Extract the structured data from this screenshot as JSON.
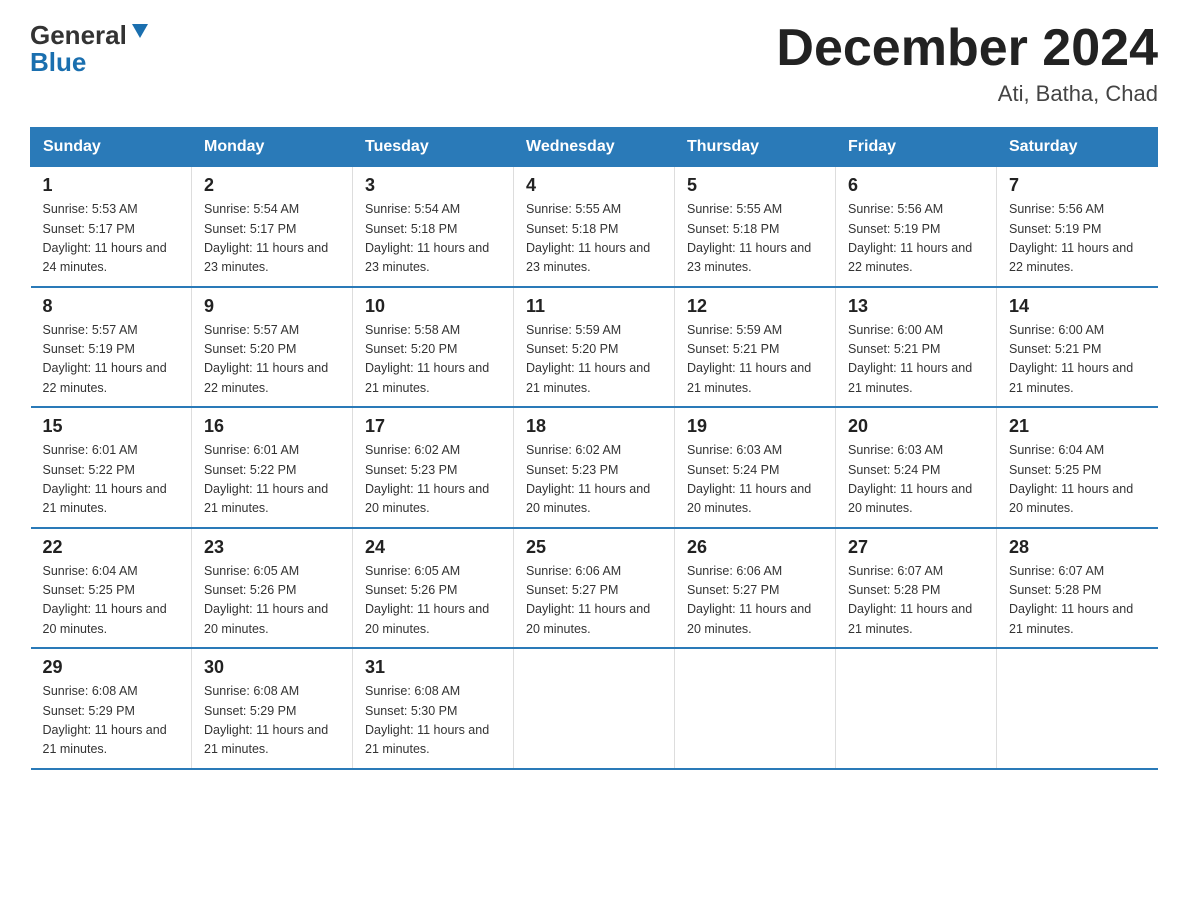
{
  "header": {
    "title": "December 2024",
    "location": "Ati, Batha, Chad",
    "logo_general": "General",
    "logo_blue": "Blue"
  },
  "days_of_week": [
    "Sunday",
    "Monday",
    "Tuesday",
    "Wednesday",
    "Thursday",
    "Friday",
    "Saturday"
  ],
  "weeks": [
    [
      {
        "day": "1",
        "sunrise": "5:53 AM",
        "sunset": "5:17 PM",
        "daylight": "11 hours and 24 minutes."
      },
      {
        "day": "2",
        "sunrise": "5:54 AM",
        "sunset": "5:17 PM",
        "daylight": "11 hours and 23 minutes."
      },
      {
        "day": "3",
        "sunrise": "5:54 AM",
        "sunset": "5:18 PM",
        "daylight": "11 hours and 23 minutes."
      },
      {
        "day": "4",
        "sunrise": "5:55 AM",
        "sunset": "5:18 PM",
        "daylight": "11 hours and 23 minutes."
      },
      {
        "day": "5",
        "sunrise": "5:55 AM",
        "sunset": "5:18 PM",
        "daylight": "11 hours and 23 minutes."
      },
      {
        "day": "6",
        "sunrise": "5:56 AM",
        "sunset": "5:19 PM",
        "daylight": "11 hours and 22 minutes."
      },
      {
        "day": "7",
        "sunrise": "5:56 AM",
        "sunset": "5:19 PM",
        "daylight": "11 hours and 22 minutes."
      }
    ],
    [
      {
        "day": "8",
        "sunrise": "5:57 AM",
        "sunset": "5:19 PM",
        "daylight": "11 hours and 22 minutes."
      },
      {
        "day": "9",
        "sunrise": "5:57 AM",
        "sunset": "5:20 PM",
        "daylight": "11 hours and 22 minutes."
      },
      {
        "day": "10",
        "sunrise": "5:58 AM",
        "sunset": "5:20 PM",
        "daylight": "11 hours and 21 minutes."
      },
      {
        "day": "11",
        "sunrise": "5:59 AM",
        "sunset": "5:20 PM",
        "daylight": "11 hours and 21 minutes."
      },
      {
        "day": "12",
        "sunrise": "5:59 AM",
        "sunset": "5:21 PM",
        "daylight": "11 hours and 21 minutes."
      },
      {
        "day": "13",
        "sunrise": "6:00 AM",
        "sunset": "5:21 PM",
        "daylight": "11 hours and 21 minutes."
      },
      {
        "day": "14",
        "sunrise": "6:00 AM",
        "sunset": "5:21 PM",
        "daylight": "11 hours and 21 minutes."
      }
    ],
    [
      {
        "day": "15",
        "sunrise": "6:01 AM",
        "sunset": "5:22 PM",
        "daylight": "11 hours and 21 minutes."
      },
      {
        "day": "16",
        "sunrise": "6:01 AM",
        "sunset": "5:22 PM",
        "daylight": "11 hours and 21 minutes."
      },
      {
        "day": "17",
        "sunrise": "6:02 AM",
        "sunset": "5:23 PM",
        "daylight": "11 hours and 20 minutes."
      },
      {
        "day": "18",
        "sunrise": "6:02 AM",
        "sunset": "5:23 PM",
        "daylight": "11 hours and 20 minutes."
      },
      {
        "day": "19",
        "sunrise": "6:03 AM",
        "sunset": "5:24 PM",
        "daylight": "11 hours and 20 minutes."
      },
      {
        "day": "20",
        "sunrise": "6:03 AM",
        "sunset": "5:24 PM",
        "daylight": "11 hours and 20 minutes."
      },
      {
        "day": "21",
        "sunrise": "6:04 AM",
        "sunset": "5:25 PM",
        "daylight": "11 hours and 20 minutes."
      }
    ],
    [
      {
        "day": "22",
        "sunrise": "6:04 AM",
        "sunset": "5:25 PM",
        "daylight": "11 hours and 20 minutes."
      },
      {
        "day": "23",
        "sunrise": "6:05 AM",
        "sunset": "5:26 PM",
        "daylight": "11 hours and 20 minutes."
      },
      {
        "day": "24",
        "sunrise": "6:05 AM",
        "sunset": "5:26 PM",
        "daylight": "11 hours and 20 minutes."
      },
      {
        "day": "25",
        "sunrise": "6:06 AM",
        "sunset": "5:27 PM",
        "daylight": "11 hours and 20 minutes."
      },
      {
        "day": "26",
        "sunrise": "6:06 AM",
        "sunset": "5:27 PM",
        "daylight": "11 hours and 20 minutes."
      },
      {
        "day": "27",
        "sunrise": "6:07 AM",
        "sunset": "5:28 PM",
        "daylight": "11 hours and 21 minutes."
      },
      {
        "day": "28",
        "sunrise": "6:07 AM",
        "sunset": "5:28 PM",
        "daylight": "11 hours and 21 minutes."
      }
    ],
    [
      {
        "day": "29",
        "sunrise": "6:08 AM",
        "sunset": "5:29 PM",
        "daylight": "11 hours and 21 minutes."
      },
      {
        "day": "30",
        "sunrise": "6:08 AM",
        "sunset": "5:29 PM",
        "daylight": "11 hours and 21 minutes."
      },
      {
        "day": "31",
        "sunrise": "6:08 AM",
        "sunset": "5:30 PM",
        "daylight": "11 hours and 21 minutes."
      },
      null,
      null,
      null,
      null
    ]
  ],
  "colors": {
    "header_bg": "#2a7ab8",
    "header_text": "#ffffff",
    "border": "#2a7ab8"
  }
}
